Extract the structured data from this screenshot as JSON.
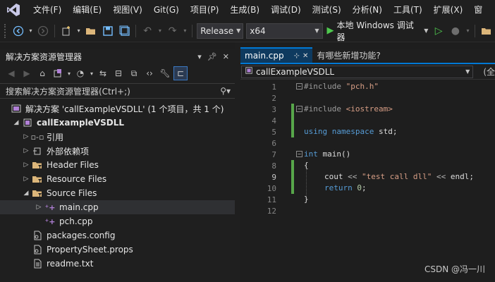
{
  "menubar": {
    "items": [
      "文件(F)",
      "编辑(E)",
      "视图(V)",
      "Git(G)",
      "项目(P)",
      "生成(B)",
      "调试(D)",
      "测试(S)",
      "分析(N)",
      "工具(T)",
      "扩展(X)",
      "窗"
    ]
  },
  "toolbar": {
    "configuration": "Release",
    "platform": "x64",
    "debug_target": "本地 Windows 调试器"
  },
  "solution_explorer": {
    "title": "解决方案资源管理器",
    "search_placeholder": "搜索解决方案资源管理器(Ctrl+;)",
    "tree": [
      {
        "label": "解决方案 'callExampleVSDLL' (1 个项目，共 1 个)",
        "icon": "solution-icon"
      },
      {
        "label": "callExampleVSDLL",
        "icon": "cpp-project-icon"
      },
      {
        "label": "引用",
        "icon": "references-icon"
      },
      {
        "label": "外部依赖项",
        "icon": "external-deps-icon"
      },
      {
        "label": "Header Files",
        "icon": "filter-folder-icon"
      },
      {
        "label": "Resource Files",
        "icon": "filter-folder-icon"
      },
      {
        "label": "Source Files",
        "icon": "filter-folder-icon"
      },
      {
        "label": "main.cpp",
        "icon": "cpp-file-icon"
      },
      {
        "label": "pch.cpp",
        "icon": "cpp-file-icon"
      },
      {
        "label": "packages.config",
        "icon": "config-file-icon"
      },
      {
        "label": "PropertySheet.props",
        "icon": "props-file-icon"
      },
      {
        "label": "readme.txt",
        "icon": "text-file-icon"
      }
    ]
  },
  "editor": {
    "tabs": [
      {
        "label": "main.cpp",
        "active": true
      },
      {
        "label": "有哪些新增功能?",
        "active": false
      }
    ],
    "nav_project": "callExampleVSDLL",
    "nav_right": "(全",
    "line_numbers": [
      "1",
      "2",
      "3",
      "4",
      "5",
      "6",
      "7",
      "8",
      "9",
      "10",
      "11",
      "12"
    ],
    "lines": {
      "l1_directive": "#include",
      "l1_header": "\"pch.h\"",
      "l3_directive": "#include",
      "l3_header": "<iostream>",
      "l5_kw1": "using",
      "l5_kw2": "namespace",
      "l5_rest": "std;",
      "l7_kw": "int",
      "l7_rest": "main()",
      "l8": "{",
      "l9_cout": "cout",
      "l9_op1": "<<",
      "l9_str": "\"test call dll\"",
      "l9_op2": "<<",
      "l9_endl": "endl;",
      "l10_kw": "return",
      "l10_num": "0",
      "l10_semi": ";",
      "l11": "}"
    }
  },
  "watermark": "CSDN @冯一川"
}
